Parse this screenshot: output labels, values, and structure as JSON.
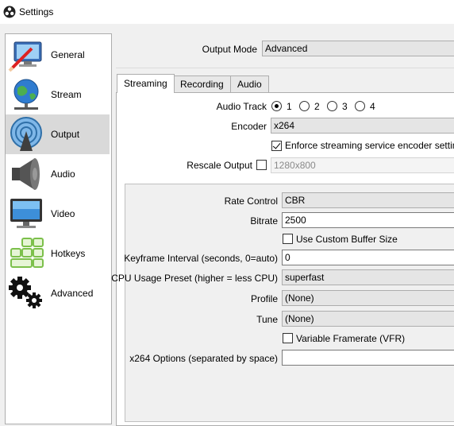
{
  "window": {
    "title": "Settings",
    "icon": "obs-logo-icon"
  },
  "sidebar": {
    "items": [
      {
        "label": "General",
        "icon": "monitor-pencil-icon",
        "selected": false
      },
      {
        "label": "Stream",
        "icon": "globe-network-icon",
        "selected": false
      },
      {
        "label": "Output",
        "icon": "broadcast-icon",
        "selected": true
      },
      {
        "label": "Audio",
        "icon": "speaker-icon",
        "selected": false
      },
      {
        "label": "Video",
        "icon": "monitor-icon",
        "selected": false
      },
      {
        "label": "Hotkeys",
        "icon": "keyboard-keys-icon",
        "selected": false
      },
      {
        "label": "Advanced",
        "icon": "gears-icon",
        "selected": false
      }
    ]
  },
  "output_mode": {
    "label": "Output Mode",
    "value": "Advanced"
  },
  "tabs": [
    {
      "label": "Streaming",
      "active": true
    },
    {
      "label": "Recording",
      "active": false
    },
    {
      "label": "Audio",
      "active": false
    }
  ],
  "streaming": {
    "audio_track": {
      "label": "Audio Track",
      "options": [
        "1",
        "2",
        "3",
        "4"
      ],
      "selected": "1"
    },
    "encoder": {
      "label": "Encoder",
      "value": "x264"
    },
    "enforce": {
      "label": "Enforce streaming service encoder settings",
      "checked": true
    },
    "rescale": {
      "label": "Rescale Output",
      "checked": false,
      "value": "1280x800"
    }
  },
  "encoder_settings": {
    "rate_control": {
      "label": "Rate Control",
      "value": "CBR"
    },
    "bitrate": {
      "label": "Bitrate",
      "value": "2500"
    },
    "custom_buffer": {
      "label": "Use Custom Buffer Size",
      "checked": false
    },
    "keyframe": {
      "label": "Keyframe Interval (seconds, 0=auto)",
      "value": "0"
    },
    "cpu_preset": {
      "label": "CPU Usage Preset (higher = less CPU)",
      "value": "superfast"
    },
    "profile": {
      "label": "Profile",
      "value": "(None)"
    },
    "tune": {
      "label": "Tune",
      "value": "(None)"
    },
    "vfr": {
      "label": "Variable Framerate (VFR)",
      "checked": false
    },
    "x264_options": {
      "label": "x264 Options (separated by space)",
      "value": ""
    }
  }
}
